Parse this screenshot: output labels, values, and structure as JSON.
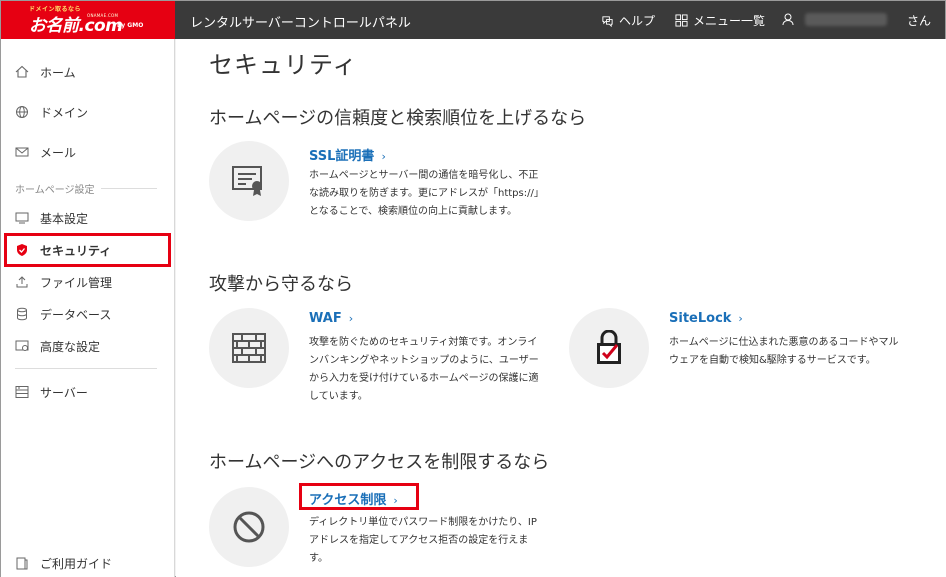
{
  "header": {
    "logo_tag": "ドメイン取るなら",
    "logo_main": "お名前.com",
    "logo_sub": "ONAMAE.COM",
    "logo_gmo": "by GMO",
    "app_title": "レンタルサーバーコントロールパネル",
    "help_label": "ヘルプ",
    "menu_label": "メニュー一覧",
    "user_suffix": "さん"
  },
  "sidebar": {
    "items": [
      {
        "label": "ホーム",
        "icon": "home-icon"
      },
      {
        "label": "ドメイン",
        "icon": "globe-icon"
      },
      {
        "label": "メール",
        "icon": "mail-icon"
      }
    ],
    "section_label": "ホームページ設定",
    "site_items": [
      {
        "label": "基本設定",
        "icon": "monitor-icon"
      },
      {
        "label": "セキュリティ",
        "icon": "shield-icon"
      },
      {
        "label": "ファイル管理",
        "icon": "upload-icon"
      },
      {
        "label": "データベース",
        "icon": "database-icon"
      },
      {
        "label": "高度な設定",
        "icon": "advanced-settings-icon"
      }
    ],
    "server_label": "サーバー",
    "guide_label": "ご利用ガイド"
  },
  "main": {
    "title": "セキュリティ",
    "sections": [
      {
        "heading": "ホームページの信頼度と検索順位を上げるなら",
        "features": [
          {
            "title": "SSL証明書",
            "desc": [
              "ホームページとサーバー間の通信を暗号化し、不正",
              "な読み取りを防ぎます。更にアドレスが「https://」",
              "となることで、検索順位の向上に貢献します。"
            ]
          }
        ]
      },
      {
        "heading": "攻撃から守るなら",
        "features": [
          {
            "title": "WAF",
            "desc": [
              "攻撃を防ぐためのセキュリティ対策です。オンライ",
              "ンバンキングやネットショップのように、ユーザー",
              "から入力を受け付けているホームページの保護に適",
              "しています。"
            ]
          },
          {
            "title": "SiteLock",
            "desc": [
              "ホームページに仕込まれた悪意のあるコードやマル",
              "ウェアを自動で検知&駆除するサービスです。"
            ]
          }
        ]
      },
      {
        "heading": "ホームページへのアクセスを制限するなら",
        "features": [
          {
            "title": "アクセス制限",
            "desc": [
              "ディレクトリ単位でパスワード制限をかけたり、IP",
              "アドレスを指定してアクセス拒否の設定を行えま",
              "す。"
            ]
          }
        ]
      }
    ],
    "chevron": "›"
  },
  "colors": {
    "brand_red": "#e60012",
    "header_bg": "#3a3a3a",
    "link_blue": "#1a6fb8"
  }
}
